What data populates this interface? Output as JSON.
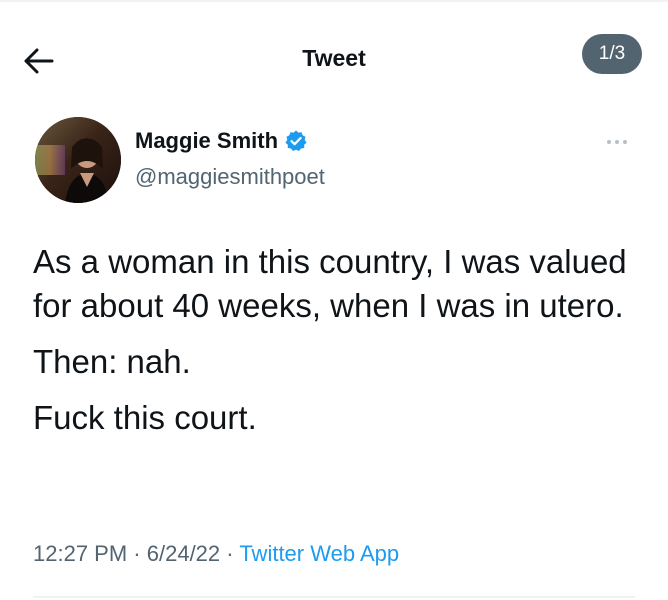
{
  "header": {
    "title": "Tweet",
    "page_indicator": "1/3"
  },
  "author": {
    "name": "Maggie Smith",
    "handle": "@maggiesmithpoet",
    "verified": true
  },
  "tweet": {
    "paragraphs": [
      "As a woman in this country, I was valued for about 40 weeks, when I was in utero.",
      "Then: nah.",
      "Fuck this court."
    ],
    "time": "12:27 PM",
    "date": "6/24/22",
    "separator": "·",
    "source": "Twitter Web App"
  },
  "colors": {
    "text": "#0f1419",
    "secondary": "#536471",
    "accent": "#1d9bf0",
    "badge": "#536471"
  },
  "icons": {
    "back": "arrow-left-icon",
    "verified": "verified-badge-icon",
    "more": "more-horizontal-icon"
  }
}
